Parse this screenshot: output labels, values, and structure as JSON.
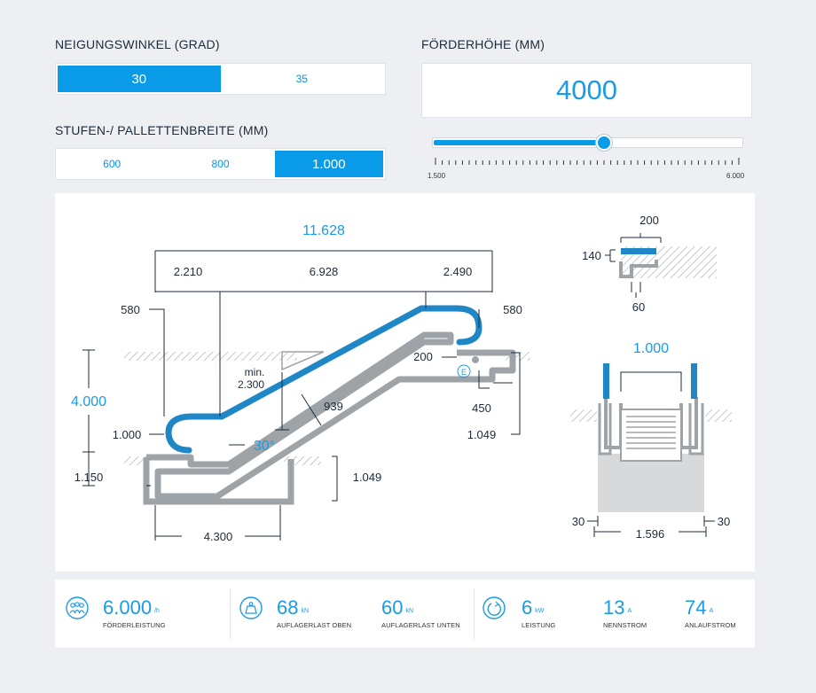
{
  "angle": {
    "label": "NEIGUNGSWINKEL (GRAD)",
    "options": [
      "30",
      "35"
    ],
    "selected": "30"
  },
  "width": {
    "label": "STUFEN-/ PALLETTENBREITE (MM)",
    "options": [
      "600",
      "800",
      "1.000"
    ],
    "selected": "1.000"
  },
  "height": {
    "label": "FÖRDERHÖHE (MM)",
    "value": "4000",
    "slider_min_label": "1.500",
    "slider_max_label": "6.000",
    "slider_fraction": 0.556
  },
  "side_diagram": {
    "total_length": "11.628",
    "seg_left": "2.210",
    "seg_mid": "6.928",
    "seg_right": "2.490",
    "top_left_580": "580",
    "top_right_580": "580",
    "min_label": "min.",
    "min_value": "2.300",
    "dim_200": "200",
    "dim_450": "450",
    "dim_1049_right": "1.049",
    "height_value": "4.000",
    "dim_1000": "1.000",
    "dim_1150": "1.150",
    "dim_939": "939",
    "angle_label": "30°",
    "dim_1049_pit": "1.049",
    "dim_4300": "4.300",
    "e_marker": "E"
  },
  "handrail_detail": {
    "dim_200": "200",
    "dim_140": "140",
    "dim_60": "60"
  },
  "cross_section": {
    "width": "1.000",
    "left_30": "30",
    "right_30": "30",
    "total": "1.596"
  },
  "stats": [
    {
      "icon": "people-icon",
      "value": "6.000",
      "unit": "/h",
      "label": "FÖRDERLEISTUNG"
    },
    {
      "icon": "weight-icon",
      "value": "68",
      "unit": "kN",
      "label": "AUFLAGERLAST OBEN"
    },
    {
      "icon": "",
      "value": "60",
      "unit": "kN",
      "label": "AUFLAGERLAST UNTEN"
    },
    {
      "icon": "power-icon",
      "value": "6",
      "unit": "kW",
      "label": "LEISTUNG"
    },
    {
      "icon": "",
      "value": "13",
      "unit": "A",
      "label": "NENNSTROM"
    },
    {
      "icon": "",
      "value": "74",
      "unit": "A",
      "label": "ANLAUFSTROM"
    }
  ],
  "colors": {
    "accent": "#0a9be8",
    "handrail": "#1f87c6",
    "steel": "#9ea3a8",
    "navy": "#1c2b3a"
  }
}
